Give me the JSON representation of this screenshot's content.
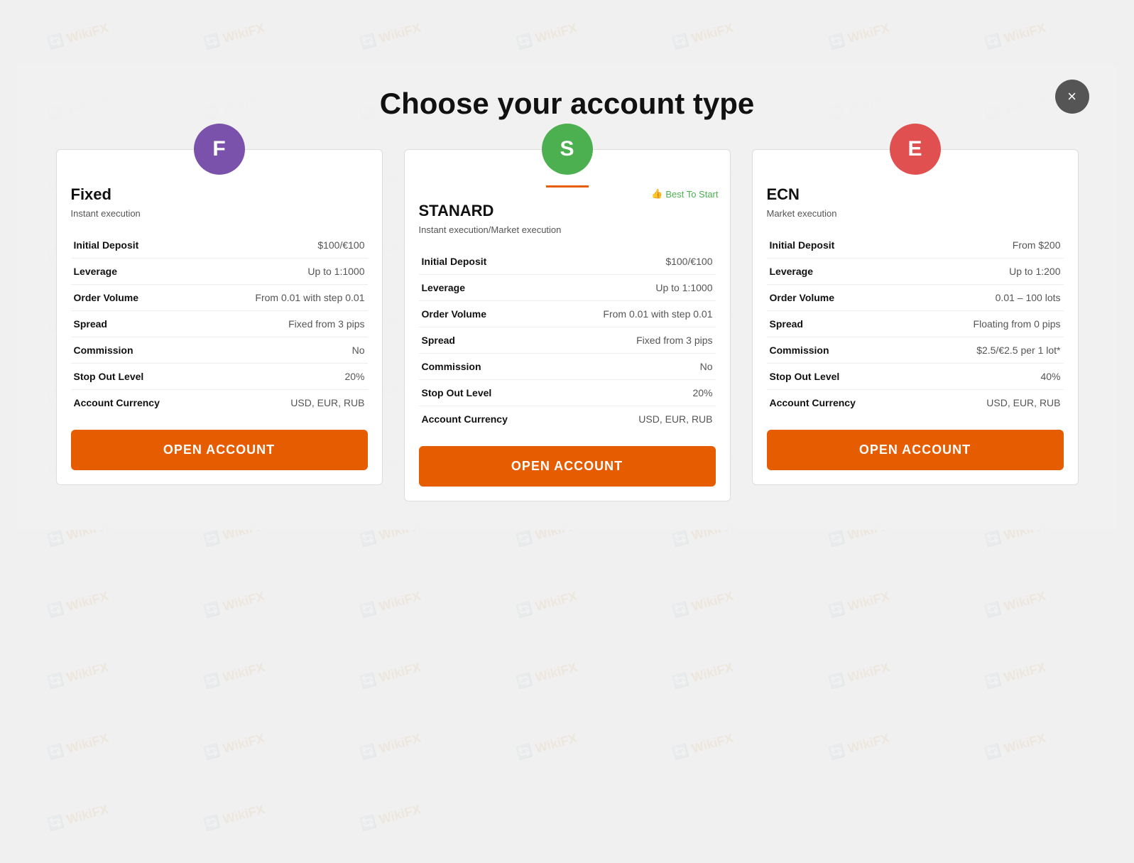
{
  "page": {
    "title": "Choose your account type",
    "close_label": "×",
    "wikifx_watermark": "WikiFX"
  },
  "cards": [
    {
      "id": "fixed",
      "icon_letter": "F",
      "icon_color": "purple",
      "title": "Fixed",
      "subtitle": "Instant execution",
      "underline_visible": false,
      "best_badge": null,
      "rows": [
        {
          "label": "Initial Deposit",
          "value": "$100/€100"
        },
        {
          "label": "Leverage",
          "value": "Up to 1:1000"
        },
        {
          "label": "Order Volume",
          "value": "From 0.01 with step 0.01"
        },
        {
          "label": "Spread",
          "value": "Fixed from 3 pips"
        },
        {
          "label": "Commission",
          "value": "No"
        },
        {
          "label": "Stop Out Level",
          "value": "20%"
        },
        {
          "label": "Account Currency",
          "value": "USD, EUR, RUB"
        }
      ],
      "button_label": "OPEN ACCOUNT"
    },
    {
      "id": "stanard",
      "icon_letter": "S",
      "icon_color": "green",
      "title": "STANARD",
      "subtitle": "Instant execution/Market execution",
      "underline_visible": true,
      "best_badge": "Best To Start",
      "rows": [
        {
          "label": "Initial Deposit",
          "value": "$100/€100"
        },
        {
          "label": "Leverage",
          "value": "Up to 1:1000"
        },
        {
          "label": "Order Volume",
          "value": "From 0.01 with step 0.01"
        },
        {
          "label": "Spread",
          "value": "Fixed from 3 pips"
        },
        {
          "label": "Commission",
          "value": "No"
        },
        {
          "label": "Stop Out Level",
          "value": "20%"
        },
        {
          "label": "Account Currency",
          "value": "USD, EUR, RUB"
        }
      ],
      "button_label": "OPEN ACCOUNT"
    },
    {
      "id": "ecn",
      "icon_letter": "E",
      "icon_color": "red",
      "title": "ECN",
      "subtitle": "Market execution",
      "underline_visible": false,
      "best_badge": null,
      "rows": [
        {
          "label": "Initial Deposit",
          "value": "From $200"
        },
        {
          "label": "Leverage",
          "value": "Up to 1:200"
        },
        {
          "label": "Order Volume",
          "value": "0.01 – 100 lots"
        },
        {
          "label": "Spread",
          "value": "Floating from 0 pips"
        },
        {
          "label": "Commission",
          "value": "$2.5/€2.5 per 1 lot*"
        },
        {
          "label": "Stop Out Level",
          "value": "40%"
        },
        {
          "label": "Account Currency",
          "value": "USD, EUR, RUB"
        }
      ],
      "button_label": "OPEN ACCOUNT"
    }
  ]
}
